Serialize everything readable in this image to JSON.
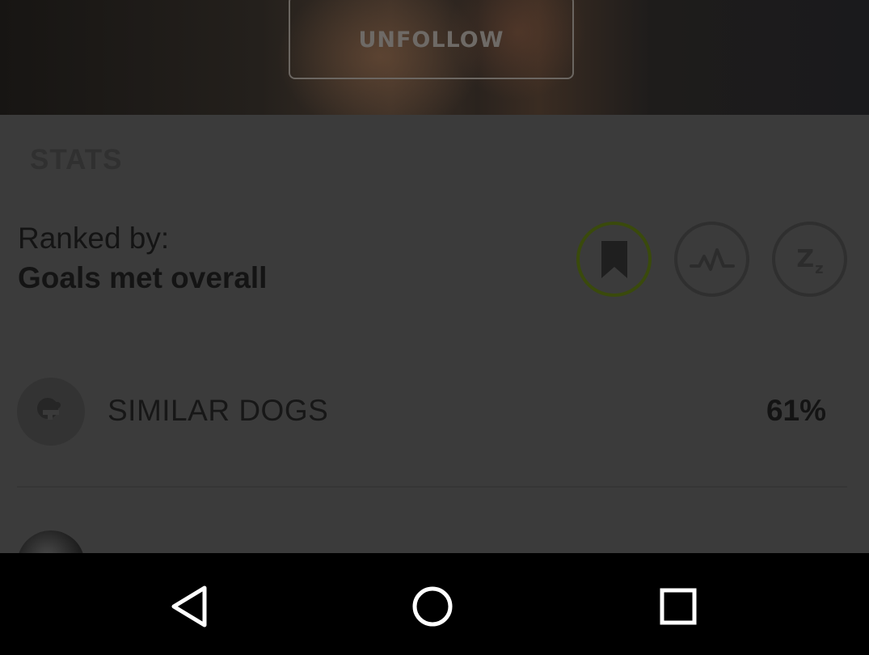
{
  "header": {
    "unfollow_label": "UNFOLLOW"
  },
  "stats": {
    "heading": "STATS",
    "ranked_by_label": "Ranked by:",
    "ranked_by_value": "Goals met overall",
    "rank_options": [
      {
        "name": "goals",
        "icon": "bookmark-icon",
        "selected": true
      },
      {
        "name": "activity",
        "icon": "activity-icon",
        "selected": false
      },
      {
        "name": "sleep",
        "icon": "sleep-zz-icon",
        "selected": false
      }
    ],
    "sleep_icon_text_big": "Z",
    "sleep_icon_text_small": "z",
    "rows": [
      {
        "name": "SIMILAR DOGS",
        "value": "61%",
        "icon": "similar-dogs-icon"
      }
    ]
  },
  "navbar": {
    "buttons": [
      "back",
      "home",
      "recents"
    ]
  },
  "colors": {
    "accent": "#3a4a0c",
    "overlay_background": "#3b3b3b",
    "navbar": "#000000"
  }
}
